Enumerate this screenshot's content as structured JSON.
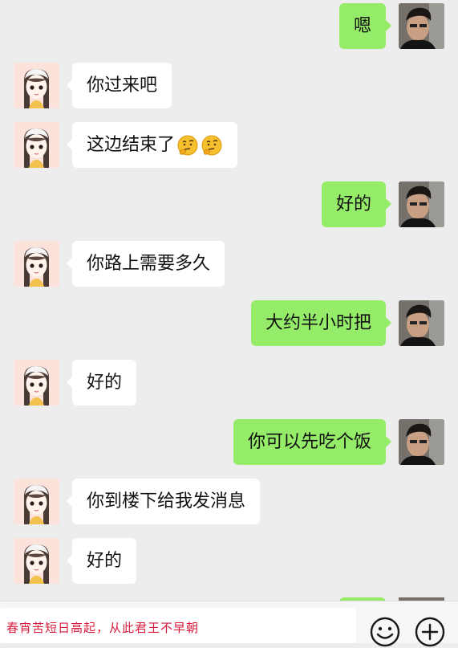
{
  "colors": {
    "background": "#ededed",
    "sent_bubble": "#95ec69",
    "received_bubble": "#ffffff",
    "input_text": "#d81b3c"
  },
  "messages": [
    {
      "side": "right",
      "text": "嗯"
    },
    {
      "side": "left",
      "text": "你过来吧"
    },
    {
      "side": "left",
      "text": "这边结束了",
      "emoji": [
        "thinking-face-icon",
        "thinking-face-icon"
      ]
    },
    {
      "side": "right",
      "text": "好的"
    },
    {
      "side": "left",
      "text": "你路上需要多久"
    },
    {
      "side": "right",
      "text": "大约半小时把"
    },
    {
      "side": "left",
      "text": "好的"
    },
    {
      "side": "right",
      "text": "你可以先吃个饭"
    },
    {
      "side": "left",
      "text": "你到楼下给我发消息"
    },
    {
      "side": "left",
      "text": "好的"
    }
  ],
  "input": {
    "value": "春宵苦短日高起，从此君王不早朝"
  },
  "toolbar": {
    "emoji_icon": "smiley-icon",
    "more_icon": "plus-circle-icon"
  }
}
